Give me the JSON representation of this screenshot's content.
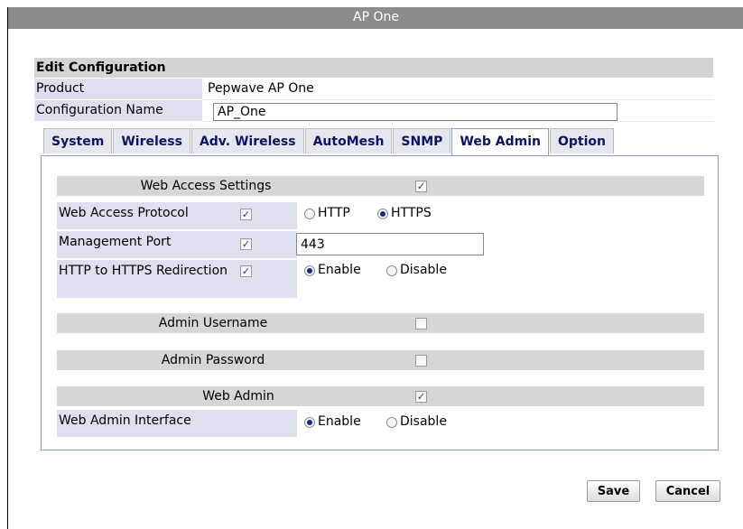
{
  "window": {
    "title": "AP One"
  },
  "edit_config": {
    "header": "Edit Configuration",
    "product_label": "Product",
    "product_value": "Pepwave AP One",
    "config_name_label": "Configuration Name",
    "config_name_value": "AP_One"
  },
  "tabs": [
    {
      "label": "System"
    },
    {
      "label": "Wireless"
    },
    {
      "label": "Adv. Wireless"
    },
    {
      "label": "AutoMesh"
    },
    {
      "label": "SNMP"
    },
    {
      "label": "Web Admin",
      "active": true
    },
    {
      "label": "Option"
    }
  ],
  "web_access": {
    "group_title": "Web Access Settings",
    "group_checked": true,
    "protocol_label": "Web Access Protocol",
    "protocol_checked": true,
    "protocol_options": [
      "HTTP",
      "HTTPS"
    ],
    "protocol_selected": "HTTPS",
    "port_label": "Management Port",
    "port_checked": true,
    "port_value": "443",
    "redirect_label": "HTTP to HTTPS Redirection",
    "redirect_checked": true,
    "redirect_options": [
      "Enable",
      "Disable"
    ],
    "redirect_selected": "Enable"
  },
  "admin_username": {
    "title": "Admin Username",
    "checked": false
  },
  "admin_password": {
    "title": "Admin Password",
    "checked": false
  },
  "web_admin": {
    "group_title": "Web Admin",
    "group_checked": true,
    "interface_label": "Web Admin Interface",
    "interface_options": [
      "Enable",
      "Disable"
    ],
    "interface_selected": "Enable"
  },
  "buttons": {
    "save": "Save",
    "cancel": "Cancel"
  }
}
